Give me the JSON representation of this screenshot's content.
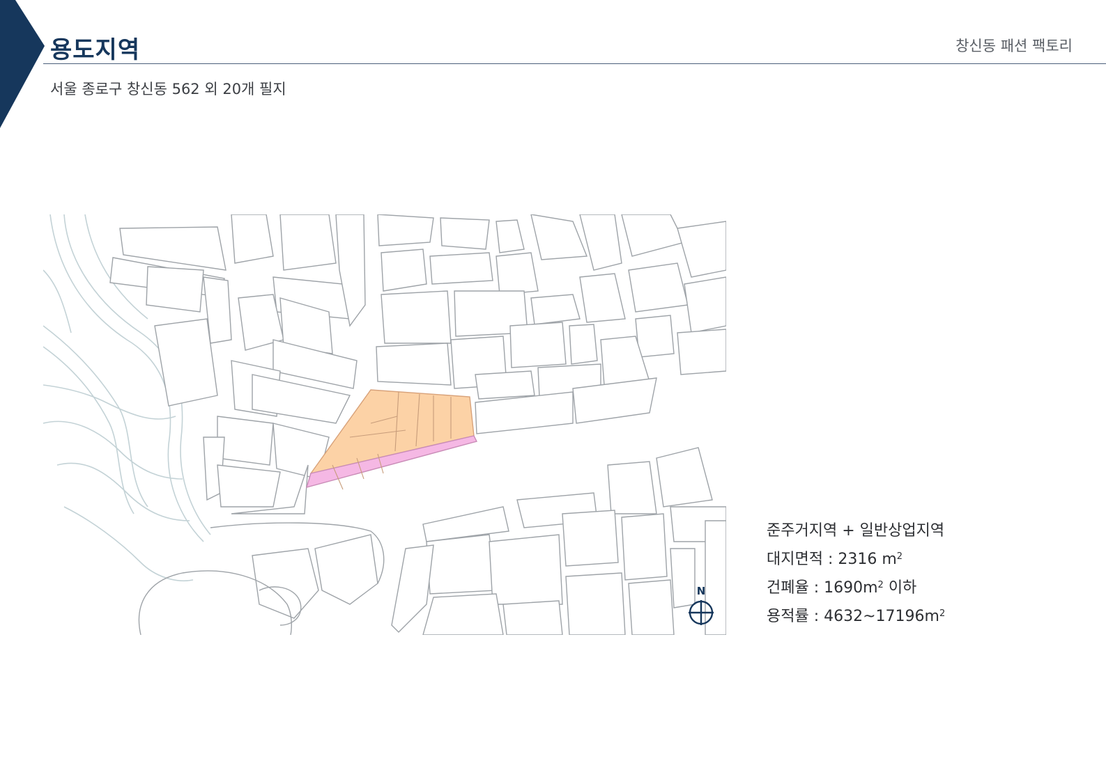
{
  "header": {
    "title": "용도지역",
    "project_name": "창신동 패션 팩토리"
  },
  "subtitle": "서울 종로구 창신동 562 외 20개 필지",
  "map": {
    "north_label": "N",
    "legend_colors": {
      "orange_zone": "#fcd2a6",
      "pink_zone": "#f5b8e4"
    }
  },
  "info": {
    "zoning": "준주거지역 + 일반상업지역",
    "site_area_label": "대지면적 : 2316 m",
    "site_area_sup": "2",
    "coverage_label": "건폐율 : 1690m",
    "coverage_sup": "2",
    "coverage_suffix": " 이하",
    "far_label": "용적률 : 4632~17196m",
    "far_sup": "2"
  },
  "colors": {
    "accent": "#16375c",
    "map_lines": "#9ea3a8",
    "contour_lines": "#c3d2d6"
  }
}
